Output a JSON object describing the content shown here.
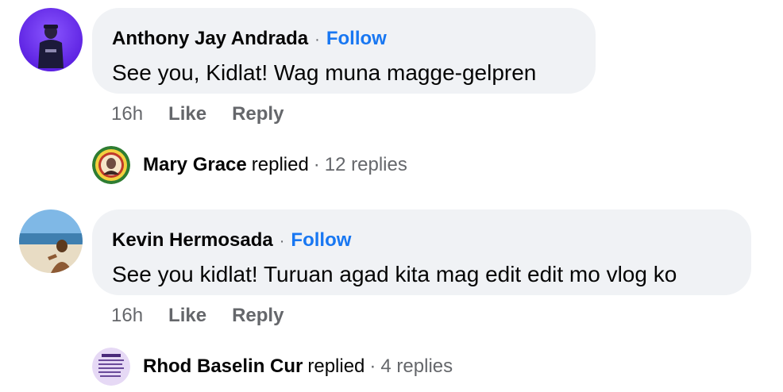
{
  "comments": [
    {
      "author": "Anthony Jay Andrada",
      "dot": "·",
      "follow_label": "Follow",
      "text": "See you, Kidlat! Wag muna magge-gelpren",
      "time": "16h",
      "like_label": "Like",
      "reply_label": "Reply",
      "reply_summary": {
        "author": "Mary Grace",
        "verb": "replied",
        "dot": "·",
        "count": "12 replies"
      }
    },
    {
      "author": "Kevin Hermosada",
      "dot": "·",
      "follow_label": "Follow",
      "text": "See you kidlat! Turuan agad kita mag edit edit mo vlog ko",
      "time": "16h",
      "like_label": "Like",
      "reply_label": "Reply",
      "reply_summary": {
        "author": "Rhod Baselin Cur",
        "verb": "replied",
        "dot": "·",
        "count": "4 replies"
      }
    }
  ],
  "colors": {
    "bubble_bg": "#f0f2f5",
    "follow_blue": "#1877f2",
    "secondary_text": "#65676b",
    "primary_text": "#050505"
  }
}
